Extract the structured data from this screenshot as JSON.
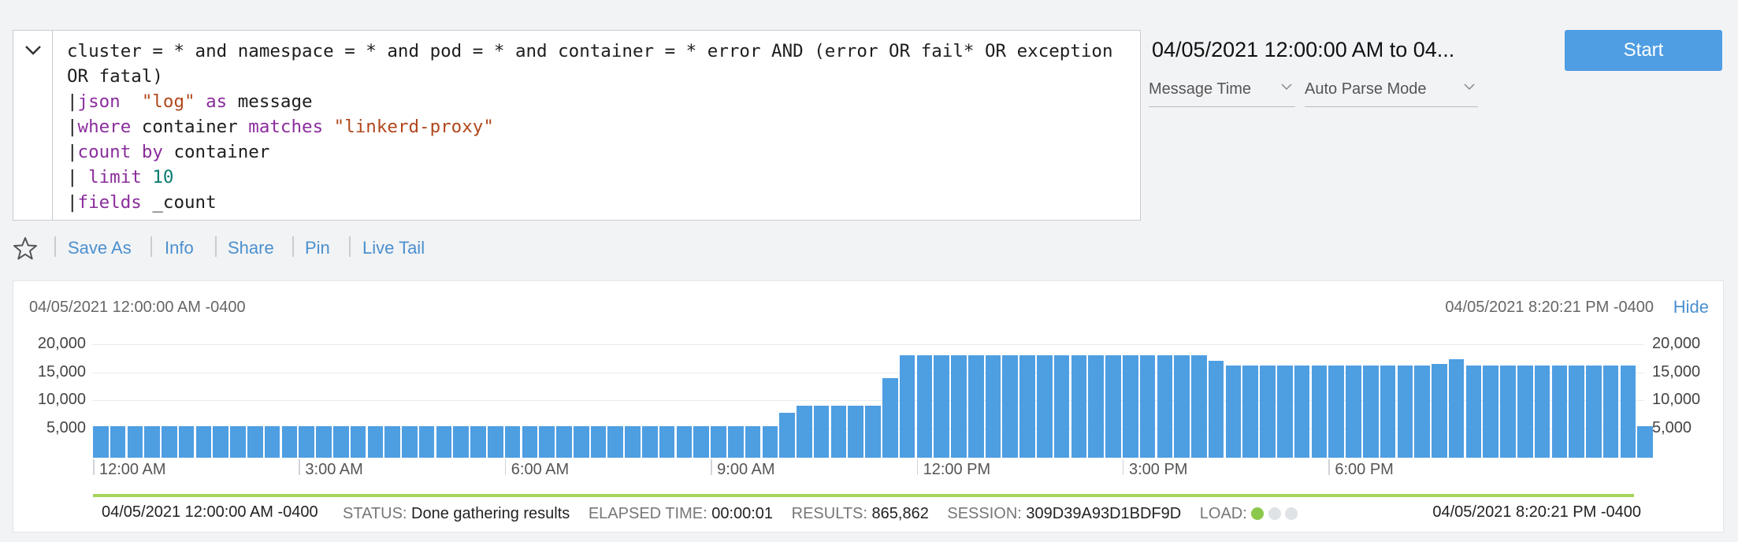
{
  "query": {
    "lines": [
      [
        {
          "t": "cluster = * and namespace = * and pod = * and container = * error AND (error OR fail* OR exception OR fatal)",
          "c": ""
        }
      ],
      [
        {
          "t": "|",
          "c": ""
        },
        {
          "t": "json",
          "c": "kw"
        },
        {
          "t": "  ",
          "c": ""
        },
        {
          "t": "\"log\"",
          "c": "str"
        },
        {
          "t": " ",
          "c": ""
        },
        {
          "t": "as",
          "c": "kw"
        },
        {
          "t": " message",
          "c": ""
        }
      ],
      [
        {
          "t": "|",
          "c": ""
        },
        {
          "t": "where",
          "c": "kw"
        },
        {
          "t": " container ",
          "c": ""
        },
        {
          "t": "matches",
          "c": "kw"
        },
        {
          "t": " ",
          "c": ""
        },
        {
          "t": "\"linkerd-proxy\"",
          "c": "str"
        }
      ],
      [
        {
          "t": "|",
          "c": ""
        },
        {
          "t": "count",
          "c": "kw"
        },
        {
          "t": " ",
          "c": ""
        },
        {
          "t": "by",
          "c": "kw"
        },
        {
          "t": " container",
          "c": ""
        }
      ],
      [
        {
          "t": "| ",
          "c": ""
        },
        {
          "t": "limit",
          "c": "kw"
        },
        {
          "t": " ",
          "c": ""
        },
        {
          "t": "10",
          "c": "num"
        }
      ],
      [
        {
          "t": "|",
          "c": ""
        },
        {
          "t": "fields",
          "c": "kw"
        },
        {
          "t": " _count",
          "c": ""
        }
      ]
    ]
  },
  "time_range": "04/05/2021 12:00:00 AM to 04...",
  "time_field_select": "Message Time",
  "parse_mode_select": "Auto Parse Mode",
  "start_label": "Start",
  "toolbar": {
    "save_as": "Save As",
    "info": "Info",
    "share": "Share",
    "pin": "Pin",
    "live_tail": "Live Tail"
  },
  "histogram": {
    "range_start": "04/05/2021 12:00:00 AM -0400",
    "range_end": "04/05/2021 8:20:21 PM -0400",
    "hide_label": "Hide"
  },
  "status": {
    "start": "04/05/2021 12:00:00 AM -0400",
    "status_label": "STATUS:",
    "status_value": "Done gathering results",
    "elapsed_label": "ELAPSED TIME:",
    "elapsed_value": "00:00:01",
    "results_label": "RESULTS:",
    "results_value": "865,862",
    "session_label": "SESSION:",
    "session_value": "309D39A93D1BDF9D",
    "load_label": "LOAD:",
    "end": "04/05/2021 8:20:21 PM -0400"
  },
  "colors": {
    "bar": "#4e9ee2",
    "accent": "#4a90cf",
    "load_active": "#8cc84b",
    "load_idle": "#dfe2e6",
    "progress": "#a6d35c"
  },
  "chart_data": {
    "type": "bar",
    "x_tick_labels": [
      "12:00 AM",
      "3:00 AM",
      "6:00 AM",
      "9:00 AM",
      "12:00 PM",
      "3:00 PM",
      "6:00 PM"
    ],
    "y_ticks": [
      5000,
      10000,
      15000,
      20000
    ],
    "y_tick_labels": [
      "5,000",
      "10,000",
      "15,000",
      "20,000"
    ],
    "ylim": [
      0,
      20000
    ],
    "interval": "15 min",
    "values": [
      5400,
      5400,
      5400,
      5400,
      5400,
      5400,
      5400,
      5400,
      5400,
      5400,
      5400,
      5400,
      5400,
      5400,
      5400,
      5400,
      5400,
      5400,
      5400,
      5400,
      5400,
      5400,
      5400,
      5400,
      5400,
      5400,
      5400,
      5400,
      5400,
      5400,
      5400,
      5400,
      5400,
      5400,
      5400,
      5400,
      5400,
      5400,
      5400,
      5400,
      7800,
      9000,
      9000,
      9000,
      9000,
      9000,
      14000,
      18000,
      18000,
      18000,
      18000,
      18000,
      18000,
      18000,
      18000,
      18000,
      18000,
      18000,
      18000,
      18000,
      18000,
      18000,
      18000,
      18000,
      18000,
      17000,
      16200,
      16200,
      16200,
      16200,
      16200,
      16200,
      16200,
      16200,
      16200,
      16200,
      16200,
      16200,
      16500,
      17300,
      16200,
      16200,
      16200,
      16200,
      16200,
      16200,
      16200,
      16200,
      16200,
      16200,
      5400
    ]
  }
}
